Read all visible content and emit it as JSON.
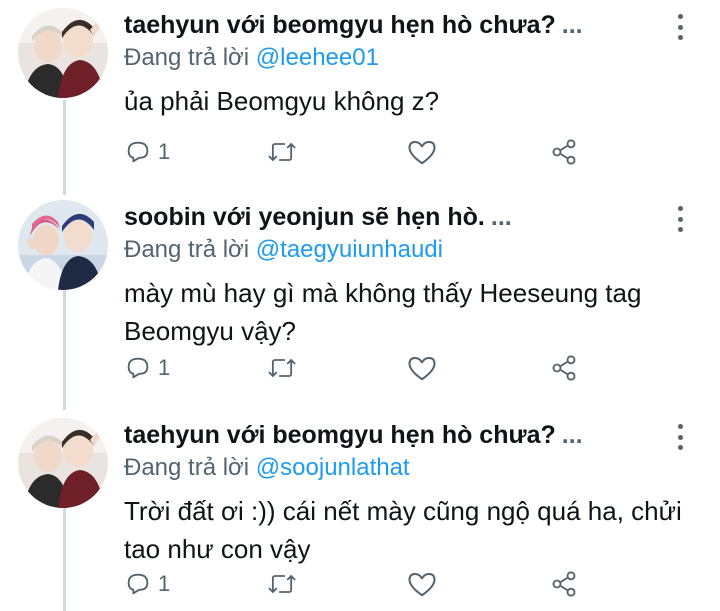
{
  "tweets": [
    {
      "name": "taehyun với beomgyu hẹn hò chưa?",
      "ellipsis": "...",
      "reply_prefix": "Đang trả lời",
      "reply_handle": "@leehee01",
      "text": "ủa phải Beomgyu không z?",
      "reply_count": "1",
      "icons": [
        "reply-icon",
        "retweet-icon",
        "like-icon",
        "share-icon"
      ]
    },
    {
      "name": "soobin với yeonjun sẽ hẹn hò.",
      "ellipsis": "...",
      "reply_prefix": "Đang trả lời",
      "reply_handle": "@taegyuiunhaudi",
      "text": "mày mù hay gì mà không thấy Heeseung tag Beomgyu vậy?",
      "reply_count": "1",
      "icons": [
        "reply-icon",
        "retweet-icon",
        "like-icon",
        "share-icon"
      ]
    },
    {
      "name": "taehyun với beomgyu hẹn hò chưa?",
      "ellipsis": "...",
      "reply_prefix": "Đang trả lời",
      "reply_handle": "@soojunlathat",
      "text": "Trời đất ơi :)) cái nết mày cũng ngộ quá ha, chửi tao như con vậy",
      "reply_count": "1",
      "icons": [
        "reply-icon",
        "retweet-icon",
        "like-icon",
        "share-icon"
      ]
    }
  ],
  "colors": {
    "text": "#0f1419",
    "secondary": "#536471",
    "link": "#1d9bf0",
    "thread_line": "#cfd9de"
  }
}
